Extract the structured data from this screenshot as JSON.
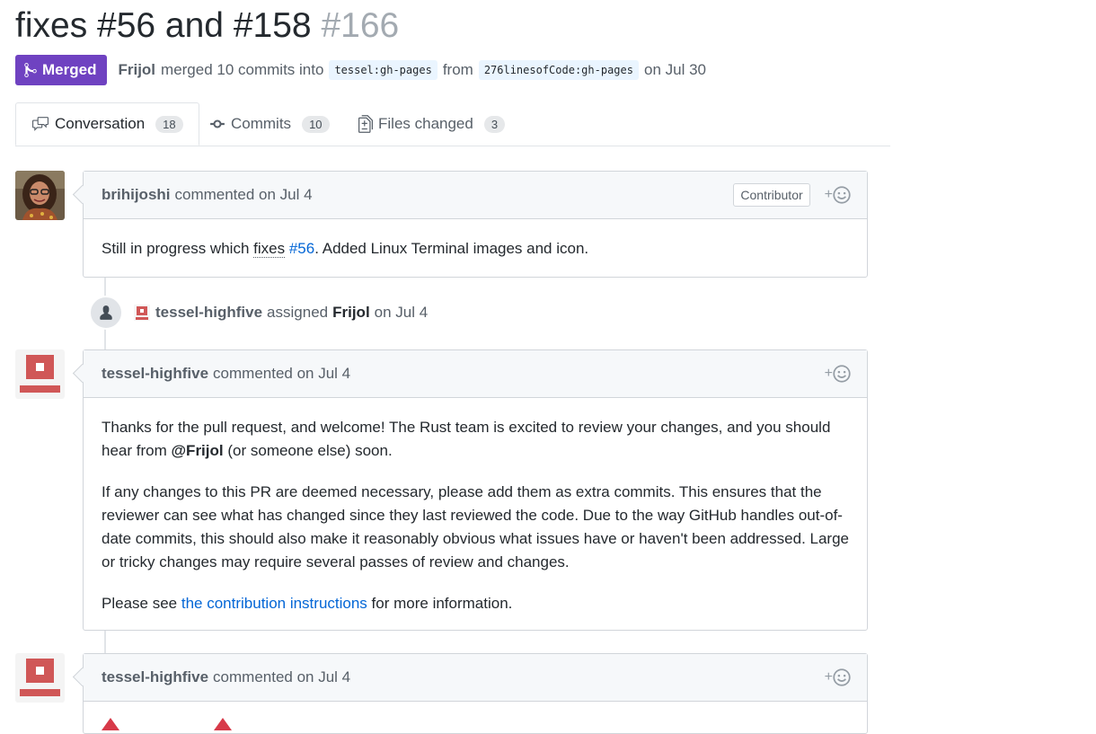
{
  "pr": {
    "title": "fixes #56 and #158",
    "number": "#166",
    "state": "Merged",
    "author": "Frijol",
    "merge_text": "merged 10 commits into",
    "base_ref": "tessel:gh-pages",
    "from_text": "from",
    "head_ref": "276linesofCode:gh-pages",
    "date_text": "on Jul 30"
  },
  "tabs": [
    {
      "label": "Conversation",
      "count": "18",
      "icon": "comment-discussion-icon"
    },
    {
      "label": "Commits",
      "count": "10",
      "icon": "git-commit-icon"
    },
    {
      "label": "Files changed",
      "count": "3",
      "icon": "file-diff-icon"
    }
  ],
  "comments": [
    {
      "author": "brihijoshi",
      "meta": "commented on Jul 4",
      "badge": "Contributor",
      "body": {
        "pre": "Still in progress which",
        "fixes": "fixes",
        "issue": "#56",
        "post": ". Added Linux Terminal images and icon."
      }
    },
    {
      "author": "tessel-highfive",
      "meta": "commented on Jul 4",
      "body": {
        "p1_pre": "Thanks for the pull request, and welcome! The Rust team is excited to review your changes, and you should hear from",
        "p1_mention": "@Frijol",
        "p1_post": "(or someone else) soon.",
        "p2": "If any changes to this PR are deemed necessary, please add them as extra commits. This ensures that the reviewer can see what has changed since they last reviewed the code. Due to the way GitHub handles out-of-date commits, this should also make it reasonably obvious what issues have or haven't been addressed. Large or tricky changes may require several passes of review and changes.",
        "p3_pre": "Please see",
        "p3_link": "the contribution instructions",
        "p3_post": "for more information."
      }
    },
    {
      "author": "tessel-highfive",
      "meta": "commented on Jul 4"
    }
  ],
  "event": {
    "actor": "tessel-highfive",
    "action": "assigned",
    "target": "Frijol",
    "date": "on Jul 4"
  },
  "colors": {
    "merged": "#6f42c1",
    "link": "#0366d6",
    "bot": "#d05757"
  }
}
